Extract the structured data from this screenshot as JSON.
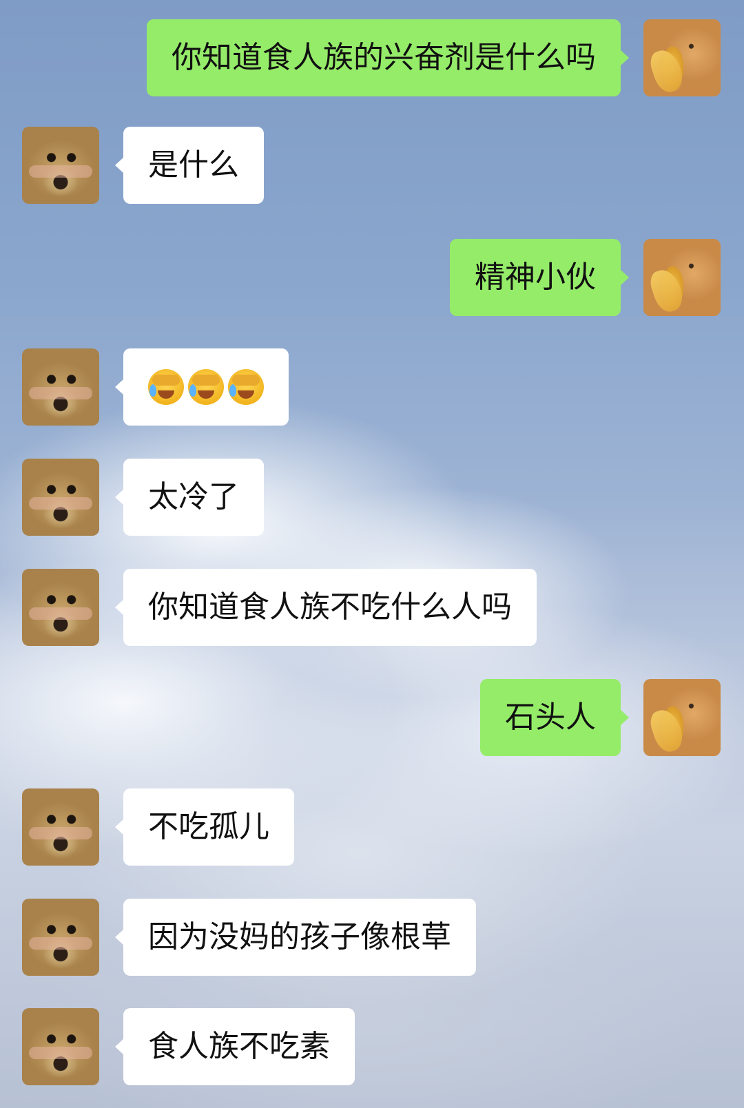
{
  "messages": [
    {
      "side": "out",
      "text": "你知道食人族的兴奋剂是什么吗"
    },
    {
      "side": "in",
      "text": "是什么"
    },
    {
      "side": "out",
      "text": "精神小伙"
    },
    {
      "side": "in",
      "emoji": [
        "face-palm-crying-emoji",
        "face-palm-crying-emoji",
        "face-palm-crying-emoji"
      ]
    },
    {
      "side": "in",
      "text": "太冷了"
    },
    {
      "side": "in",
      "text": "你知道食人族不吃什么人吗"
    },
    {
      "side": "out",
      "text": "石头人"
    },
    {
      "side": "in",
      "text": "不吃孤儿"
    },
    {
      "side": "in",
      "text": "因为没妈的孩子像根草"
    },
    {
      "side": "in",
      "text": "食人族不吃素"
    }
  ],
  "avatars": {
    "self": "cat-avatar",
    "other": "dog-avatar"
  }
}
